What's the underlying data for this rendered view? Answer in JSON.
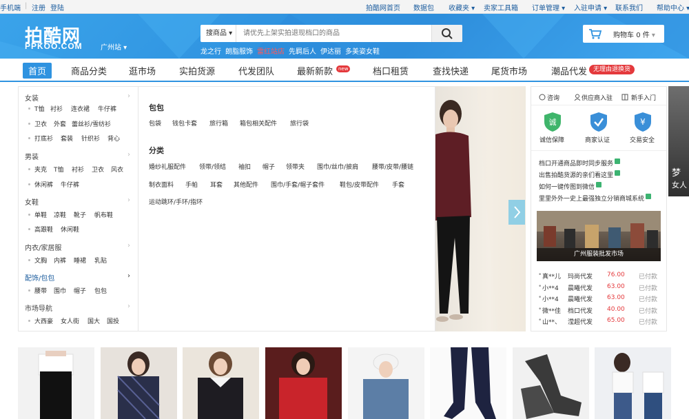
{
  "topbar": {
    "left_items": [
      "手机端",
      "注册",
      "登陆"
    ],
    "right_items": [
      "拍酷网首页",
      "数据包",
      "收藏夹",
      "卖家工具箱",
      "订单管理",
      "入驻申请",
      "联系我们",
      "帮助中心"
    ]
  },
  "header": {
    "logo": "拍酷网",
    "logo_en": "PPKOO.COM",
    "city": "广州站",
    "search_type": "搜商品",
    "search_placeholder": "请优先上架实拍退现档口的商品",
    "hot_words": [
      "龙之行",
      "朗脂服饰",
      "雷红站店",
      "先羁后人",
      "伊达丽",
      "多美姿女鞋"
    ],
    "cart_label": "购物车",
    "cart_count": "0 件"
  },
  "nav": {
    "items": [
      "首页",
      "商品分类",
      "逛市场",
      "实拍货源",
      "代发团队",
      "最新新款",
      "档口租赁",
      "查找快递",
      "尾货市场",
      "潮品代发"
    ],
    "new_badge": "new",
    "promo_badge": "无理由退换货"
  },
  "categories": [
    {
      "title": "女装",
      "rows": [
        [
          "T恤",
          "衬衫",
          "连衣裙",
          "牛仔裤"
        ],
        [
          "卫衣",
          "外套",
          "蕾丝衫/雪纺衫"
        ],
        [
          "打底衫",
          "套装",
          "针织衫",
          "背心"
        ]
      ]
    },
    {
      "title": "男装",
      "rows": [
        [
          "夹克",
          "T恤",
          "衬衫",
          "卫衣",
          "风衣"
        ],
        [
          "休闲裤",
          "牛仔裤"
        ]
      ]
    },
    {
      "title": "女鞋",
      "rows": [
        [
          "单鞋",
          "凉鞋",
          "靴子",
          "帆布鞋"
        ],
        [
          "高跟鞋",
          "休闲鞋"
        ]
      ]
    },
    {
      "title": "内衣/家居服",
      "rows": [
        [
          "文胸",
          "内裤",
          "睡裙",
          "乳贴"
        ]
      ]
    },
    {
      "title": "配饰/包包",
      "rows": [
        [
          "腰带",
          "围巾",
          "帽子",
          "包包"
        ]
      ]
    },
    {
      "title": "市场导航",
      "rows": [
        [
          "大西豪",
          "女人街",
          "国大",
          "国投"
        ]
      ]
    }
  ],
  "panel": {
    "sections": [
      {
        "title": "包包",
        "items": [
          "包袋",
          "钱包卡套",
          "旅行箱",
          "箱包相关配件",
          "旅行袋"
        ]
      },
      {
        "title": "分类",
        "items": [
          "婚纱礼服配件",
          "领带/领结",
          "袖扣",
          "帽子",
          "领带夹",
          "围巾/丝巾/披肩",
          "腰带/皮带/腰链",
          "制衣面料",
          "手帕",
          "耳套",
          "其他配件",
          "围巾/手套/帽子套件",
          "鞋包/皮带配件",
          "手套",
          "运动跳环/手环/指环"
        ]
      }
    ]
  },
  "service": {
    "links": [
      "咨询",
      "供应商入驻",
      "新手入门"
    ],
    "badges": [
      {
        "label": "诚信保障",
        "glyph": "诚",
        "color": "#3fb56b"
      },
      {
        "label": "商家认证",
        "glyph": "✓",
        "color": "#3a8fd8"
      },
      {
        "label": "交易安全",
        "glyph": "¥",
        "color": "#3a8fd8"
      }
    ],
    "news": [
      "档口开通商品即时同步服务",
      "出售拍酷货源的亲们看这里",
      "如何一键传图到微信",
      "里里外外一史上最强独立分销商城系统"
    ],
    "market_caption": "广州服装批发市场",
    "orders": [
      {
        "user": "真**儿",
        "shop": "玛尚代发",
        "price": "76.00",
        "status": "已付款"
      },
      {
        "user": "小**4",
        "shop": "晨曦代发",
        "price": "63.00",
        "status": "已付款"
      },
      {
        "user": "小**4",
        "shop": "晨曦代发",
        "price": "63.00",
        "status": "已付款"
      },
      {
        "user": "微**佳",
        "shop": "档口代发",
        "price": "40.00",
        "status": "已付款"
      },
      {
        "user": "山**、",
        "shop": "滢超代发",
        "price": "65.00",
        "status": "已付款"
      }
    ]
  },
  "edge_promo": [
    "梦",
    "女人"
  ],
  "colors": {
    "brand": "#2f93e0",
    "accent": "#e4393c"
  }
}
